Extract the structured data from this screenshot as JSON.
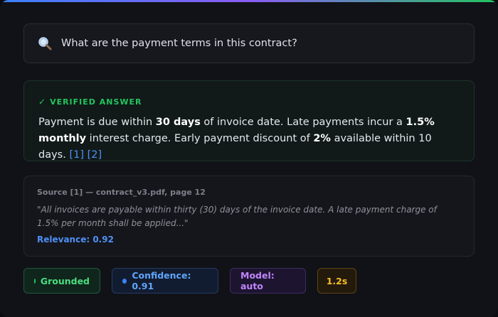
{
  "search": {
    "query": "What are the payment terms in this contract?"
  },
  "answer": {
    "label": "VERIFIED ANSWER",
    "parts": {
      "p1": "Payment is due within ",
      "b1": "30 days",
      "p2": " of invoice date. Late payments incur a ",
      "b2": "1.5% monthly",
      "p3": " interest charge. Early payment discount of ",
      "b3": "2%",
      "p4": " available within 10 days. "
    },
    "citations": [
      "[1]",
      "[2]"
    ]
  },
  "source": {
    "header": "Source [1] — contract_v3.pdf, page 12",
    "quote": "\"All invoices are payable within thirty (30) days of the invoice date. A late payment charge of 1.5% per month shall be applied...\"",
    "relevance": "Relevance: 0.92"
  },
  "badges": {
    "grounded": "Grounded",
    "confidence": "Confidence: 0.91",
    "model": "Model: auto",
    "latency": "1.2s"
  },
  "colors": {
    "verified": "#22c55e",
    "link": "#4f8ff7",
    "model": "#c084fc",
    "latency": "#fbbf24"
  }
}
